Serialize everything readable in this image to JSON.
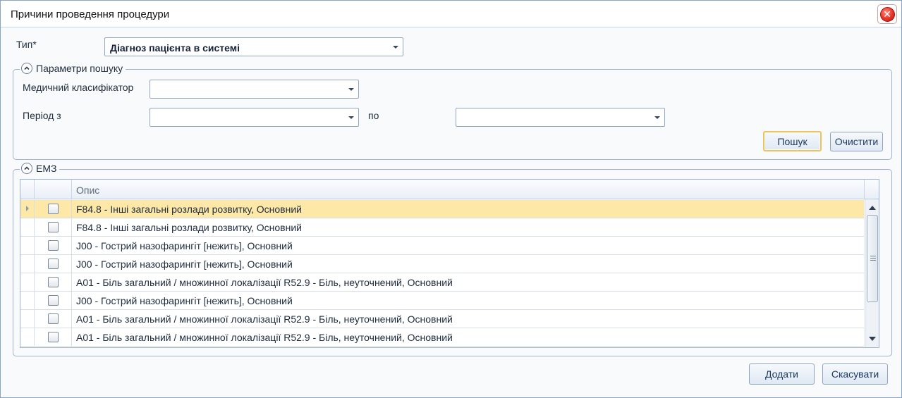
{
  "window": {
    "title": "Причини проведення процедури"
  },
  "type_field": {
    "label": "Тип*",
    "value": "Діагноз пацієнта в системі"
  },
  "search_params": {
    "legend": "Параметри пошуку",
    "classifier_label": "Медичний класифікатор",
    "classifier_value": "",
    "period_from_label": "Період з",
    "period_from_value": "",
    "period_to_label": "по",
    "period_to_value": "",
    "search_button": "Пошук",
    "clear_button": "Очистити"
  },
  "emz": {
    "legend": "ЕМЗ",
    "columns": [
      "",
      "",
      "Опис"
    ],
    "rows": [
      {
        "text": "F84.8 - Інші загальні розлади розвитку, Основний",
        "checked": false,
        "selected": true
      },
      {
        "text": "F84.8 - Інші загальні розлади розвитку, Основний",
        "checked": false,
        "selected": false
      },
      {
        "text": "J00 - Гострий назофарингіт [нежить], Основний",
        "checked": false,
        "selected": false
      },
      {
        "text": "J00 - Гострий назофарингіт [нежить], Основний",
        "checked": false,
        "selected": false
      },
      {
        "text": "A01 - Біль загальний / множинної локалізації R52.9 - Біль, неуточнений, Основний",
        "checked": false,
        "selected": false
      },
      {
        "text": "J00 - Гострий назофарингіт [нежить], Основний",
        "checked": false,
        "selected": false
      },
      {
        "text": "A01 - Біль загальний / множинної локалізації R52.9 - Біль, неуточнений, Основний",
        "checked": false,
        "selected": false
      },
      {
        "text": "A01 - Біль загальний / множинної локалізації R52.9 - Біль, неуточнений, Основний",
        "checked": false,
        "selected": false
      }
    ]
  },
  "footer": {
    "add_button": "Додати",
    "cancel_button": "Скасувати"
  },
  "icons": {
    "close": "close-icon",
    "collapse": "chevron-up-icon",
    "dropdown": "chevron-down-icon",
    "row_indicator": "row-pointer-icon"
  },
  "colors": {
    "selected_row": "#fde8a8",
    "focus_border": "#f0c35a",
    "close_red": "#e8332a"
  }
}
